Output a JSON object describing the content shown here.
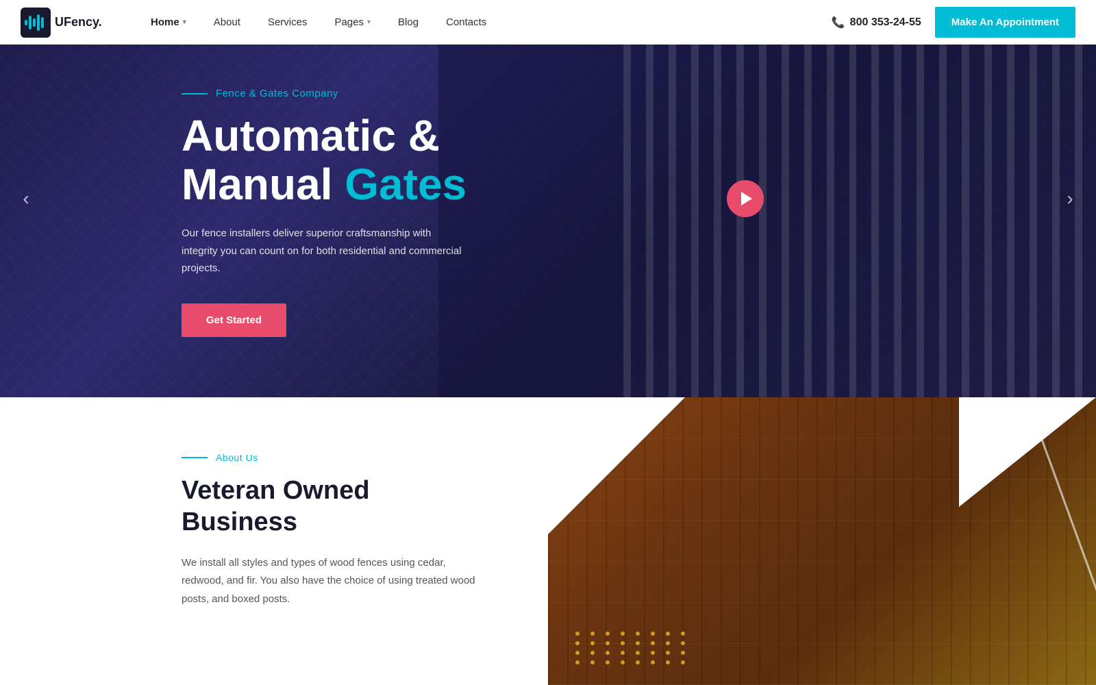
{
  "navbar": {
    "logo_text": "UFency.",
    "logo_accent": "U",
    "nav_links": [
      {
        "label": "Home",
        "has_arrow": true,
        "active": true
      },
      {
        "label": "About",
        "has_arrow": false,
        "active": false
      },
      {
        "label": "Services",
        "has_arrow": false,
        "active": false
      },
      {
        "label": "Pages",
        "has_arrow": true,
        "active": false
      },
      {
        "label": "Blog",
        "has_arrow": false,
        "active": false
      },
      {
        "label": "Contacts",
        "has_arrow": false,
        "active": false
      }
    ],
    "phone": "800 353-24-55",
    "appointment_btn": "Make An Appointment"
  },
  "hero": {
    "subtitle": "Fence & Gates Company",
    "title_line1": "Automatic &",
    "title_line2_normal": "Manual ",
    "title_line2_highlight": "Gates",
    "description": "Our fence installers deliver superior craftsmanship with integrity you can count on for both residential and commercial projects.",
    "cta_btn": "Get Started",
    "prev_arrow": "‹",
    "next_arrow": "›"
  },
  "about": {
    "subtitle": "About Us",
    "title_line1": "Veteran Owned",
    "title_line2": "Business",
    "description": "We install all styles and types of wood fences using cedar, redwood, and fir. You also have the choice of using treated wood posts, and boxed posts."
  },
  "colors": {
    "accent": "#00bcd4",
    "cta_red": "#e84c6a",
    "dark_bg": "#2a2750",
    "white": "#ffffff"
  }
}
